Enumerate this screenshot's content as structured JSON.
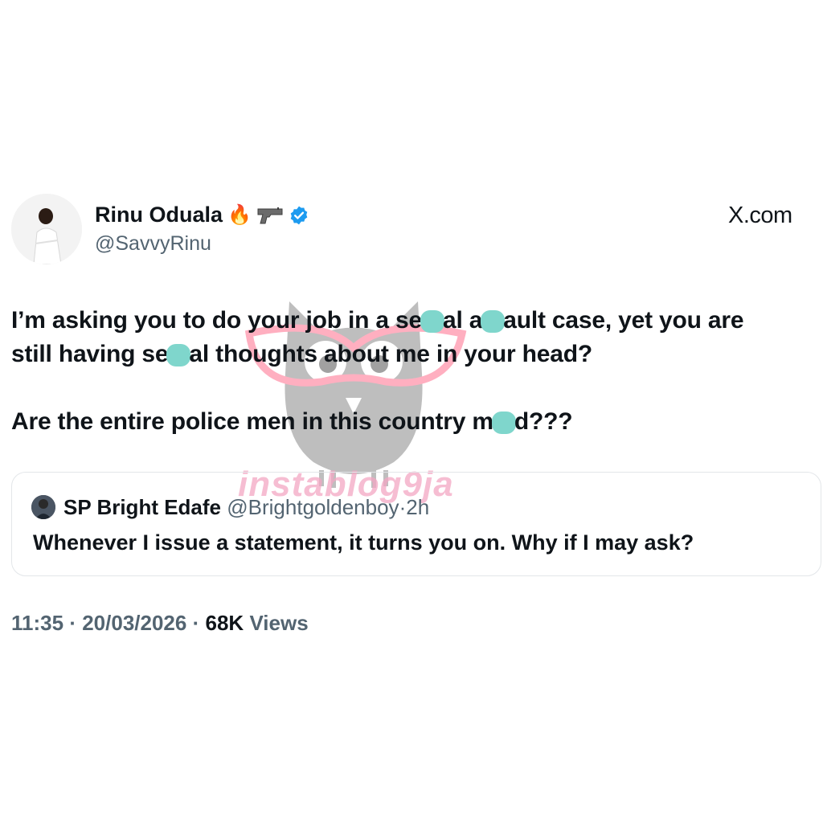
{
  "author": {
    "name": "Rinu Oduala",
    "emojis": "🔥",
    "handle": "@SavvyRinu"
  },
  "site_label": "X.com",
  "tweet": {
    "line1a": "I’m asking you to do your job in a se",
    "line1b": "al a",
    "line1c": "ault case, yet you are",
    "line2a": "still having se",
    "line2b": "al thoughts about me in your head?",
    "line3a": "Are the entire police men in this country m",
    "line3b": "d???"
  },
  "quote": {
    "name": "SP Bright Edafe",
    "handle": "@Brightgoldenboy",
    "dot": "·",
    "time": "2h",
    "text": "Whenever I issue a statement, it turns you on. Why if I may ask?"
  },
  "meta": {
    "time": "11:35",
    "sep1": "·",
    "date": "20/03/2026",
    "sep2": "·",
    "views_count": "68K",
    "views_label": "Views"
  },
  "watermark": "instablog9ja",
  "colors": {
    "verified": "#1d9bf0",
    "redaction": "#7fd6cc",
    "muted": "#536471"
  },
  "icons": [
    "verified-badge-icon",
    "pistol-icon",
    "fire-emoji",
    "owl-watermark"
  ]
}
